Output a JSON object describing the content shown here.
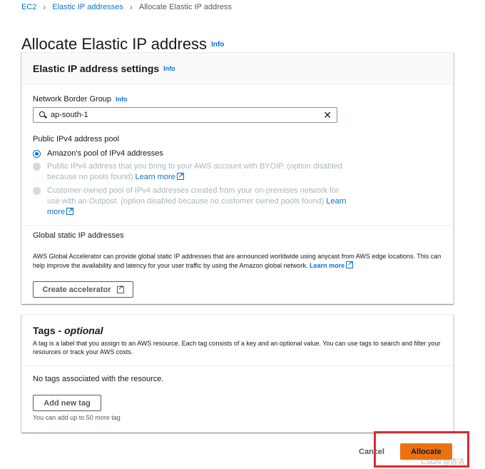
{
  "breadcrumb": {
    "items": [
      "EC2",
      "Elastic IP addresses",
      "Allocate Elastic IP address"
    ]
  },
  "page": {
    "title": "Allocate Elastic IP address",
    "info": "Info"
  },
  "settings": {
    "title": "Elastic IP address settings",
    "info": "Info",
    "border_group_label": "Network Border Group",
    "border_group_info": "Info",
    "border_group_value": "ap-south-1",
    "pool_label": "Public IPv4 address pool",
    "options": [
      {
        "text": "Amazon's pool of IPv4 addresses",
        "link": "",
        "selected": true,
        "disabled": false
      },
      {
        "text": "Public IPv4 address that you bring to your AWS account with BYOIP. (option disabled because no pools found)",
        "link": "Learn more",
        "selected": false,
        "disabled": true
      },
      {
        "text": "Customer-owned pool of IPv4 addresses created from your on-premises network for use with an Outpost. (option disabled because no customer owned pools found)",
        "link": "Learn more",
        "selected": false,
        "disabled": true
      }
    ],
    "global_title": "Global static IP addresses",
    "global_desc": "AWS Global Accelerator can provide global static IP addresses that are announced worldwide using anycast from AWS edge locations. This can help improve the availability and latency for your user traffic by using the Amazon global network.",
    "global_link": "Learn more",
    "create_accelerator_label": "Create accelerator"
  },
  "tags": {
    "title": "Tags",
    "title_suffix": "optional",
    "desc": "A tag is a label that you assign to an AWS resource. Each tag consists of a key and an optional value. You can use tags to search and filter your resources or track your AWS costs.",
    "empty_text": "No tags associated with the resource.",
    "add_label": "Add new tag",
    "limit_text": "You can add up to 50 more tag"
  },
  "footer": {
    "cancel_label": "Cancel",
    "allocate_label": "Allocate"
  },
  "watermark": "CSDN @吉洁 F",
  "colors": {
    "link": "#0972d3",
    "primary_button": "#ec7211",
    "highlight": "#d92c2c"
  }
}
